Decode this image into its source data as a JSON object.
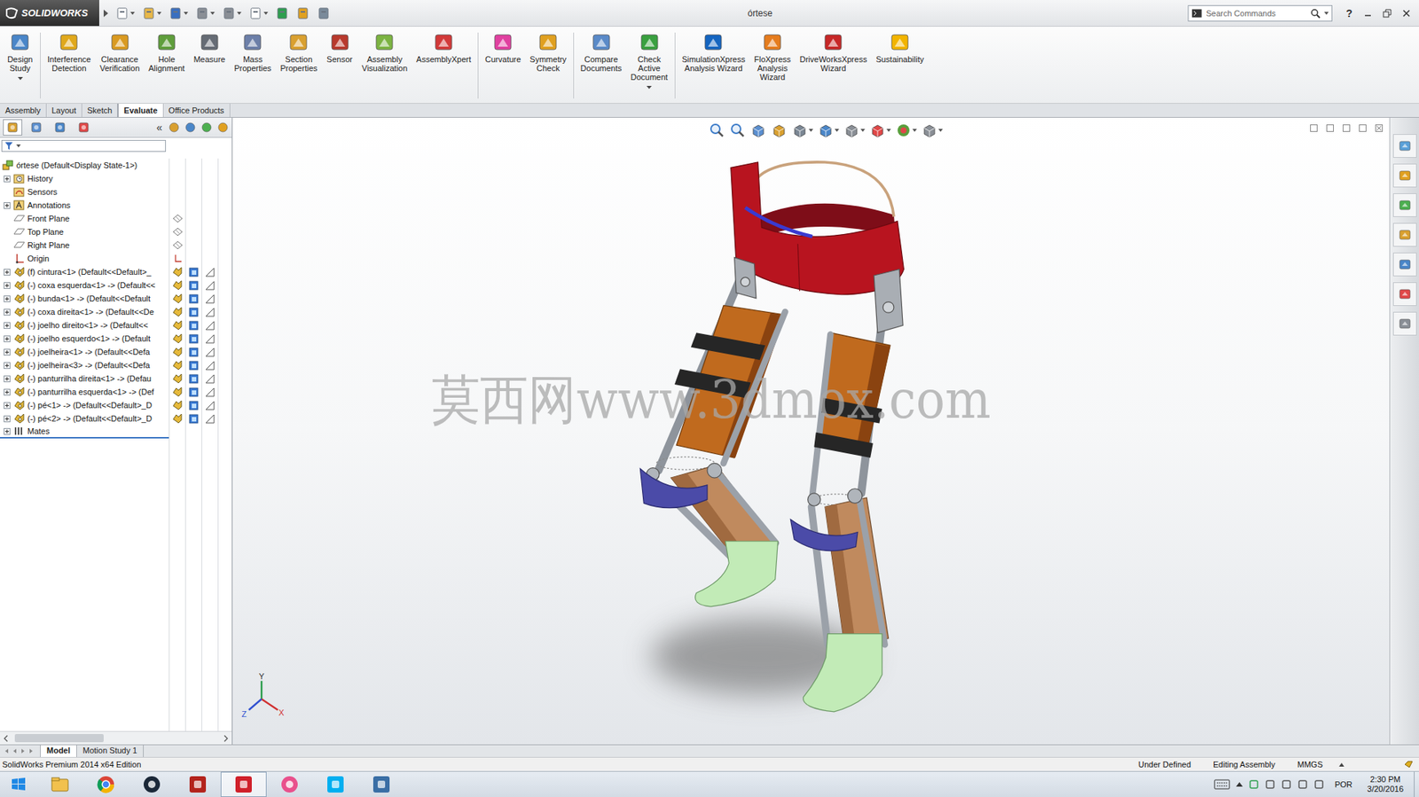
{
  "app": {
    "brand": "SOLIDWORKS"
  },
  "window": {
    "title": "órtese"
  },
  "search": {
    "placeholder": "Search Commands"
  },
  "help": "?",
  "ribbon": {
    "groups": [
      [
        {
          "label": [
            "Design",
            "Study"
          ],
          "dropdown": true
        }
      ],
      [
        {
          "label": [
            "Interference",
            "Detection"
          ],
          "dropdown": false
        },
        {
          "label": [
            "Clearance",
            "Verification"
          ],
          "dropdown": false
        },
        {
          "label": [
            "Hole",
            "Alignment"
          ],
          "dropdown": false
        },
        {
          "label": [
            "Measure"
          ],
          "dropdown": false
        },
        {
          "label": [
            "Mass",
            "Properties"
          ],
          "dropdown": false
        },
        {
          "label": [
            "Section",
            "Properties"
          ],
          "dropdown": false
        },
        {
          "label": [
            "Sensor"
          ],
          "dropdown": false
        },
        {
          "label": [
            "Assembly",
            "Visualization"
          ],
          "dropdown": false
        },
        {
          "label": [
            "AssemblyXpert"
          ],
          "dropdown": false
        }
      ],
      [
        {
          "label": [
            "Curvature"
          ],
          "dropdown": false
        },
        {
          "label": [
            "Symmetry",
            "Check"
          ],
          "dropdown": false
        }
      ],
      [
        {
          "label": [
            "Compare",
            "Documents"
          ],
          "dropdown": false
        },
        {
          "label": [
            "Check",
            "Active",
            "Document"
          ],
          "dropdown": true
        }
      ],
      [
        {
          "label": [
            "SimulationXpress",
            "Analysis Wizard"
          ],
          "dropdown": false
        },
        {
          "label": [
            "FloXpress",
            "Analysis",
            "Wizard"
          ],
          "dropdown": false
        },
        {
          "label": [
            "DriveWorksXpress",
            "Wizard"
          ],
          "dropdown": false
        },
        {
          "label": [
            "Sustainability"
          ],
          "dropdown": false
        }
      ]
    ]
  },
  "tabs": [
    {
      "label": "Assembly",
      "selected": false
    },
    {
      "label": "Layout",
      "selected": false
    },
    {
      "label": "Sketch",
      "selected": false
    },
    {
      "label": "Evaluate",
      "selected": true
    },
    {
      "label": "Office Products",
      "selected": false
    }
  ],
  "panel": {
    "tabs": [
      {
        "selected": true
      },
      {
        "selected": false
      },
      {
        "selected": false
      },
      {
        "selected": false
      }
    ],
    "collapse": "«"
  },
  "tree": [
    {
      "text": "órtese (Default<Display State-1>)",
      "kind": "root",
      "expander": false,
      "expanded": true
    },
    {
      "text": "History",
      "kind": "history",
      "expander": true,
      "expanded": false
    },
    {
      "text": "Sensors",
      "kind": "sensors",
      "expander": false,
      "expanded": false
    },
    {
      "text": "Annotations",
      "kind": "annotations",
      "expander": true,
      "expanded": false
    },
    {
      "text": "Front Plane",
      "kind": "plane",
      "expander": false,
      "expanded": false
    },
    {
      "text": "Top Plane",
      "kind": "plane",
      "expander": false,
      "expanded": false
    },
    {
      "text": "Right Plane",
      "kind": "plane",
      "expander": false,
      "expanded": false
    },
    {
      "text": "Origin",
      "kind": "origin",
      "expander": false,
      "expanded": false
    },
    {
      "text": "(f) cintura<1> (Default<<Default>_",
      "kind": "component",
      "expander": true,
      "expanded": false
    },
    {
      "text": "(-) coxa esquerda<1> -> (Default<<",
      "kind": "component",
      "expander": true,
      "expanded": false
    },
    {
      "text": "(-) bunda<1> -> (Default<<Default",
      "kind": "component",
      "expander": true,
      "expanded": false
    },
    {
      "text": "(-) coxa direita<1> -> (Default<<De",
      "kind": "component",
      "expander": true,
      "expanded": false
    },
    {
      "text": "(-) joelho direito<1> -> (Default<<",
      "kind": "component",
      "expander": true,
      "expanded": false
    },
    {
      "text": "(-) joelho esquerdo<1> -> (Default",
      "kind": "component",
      "expander": true,
      "expanded": false
    },
    {
      "text": "(-) joelheira<1> -> (Default<<Defa",
      "kind": "component",
      "expander": true,
      "expanded": false
    },
    {
      "text": "(-) joelheira<3> -> (Default<<Defa",
      "kind": "component",
      "expander": true,
      "expanded": false
    },
    {
      "text": "(-) panturrilha direita<1> -> (Defau",
      "kind": "component",
      "expander": true,
      "expanded": false
    },
    {
      "text": "(-) panturrilha esquerda<1> -> (Def",
      "kind": "component",
      "expander": true,
      "expanded": false
    },
    {
      "text": "(-) pé<1> -> (Default<<Default>_D",
      "kind": "component",
      "expander": true,
      "expanded": false
    },
    {
      "text": "(-) pé<2> -> (Default<<Default>_D",
      "kind": "component",
      "expander": true,
      "expanded": false
    },
    {
      "text": "Mates",
      "kind": "mates",
      "expander": true,
      "expanded": false
    }
  ],
  "viewport": {
    "watermark": "莫西网www.3dmox.com",
    "triad": {
      "x": "X",
      "y": "Y",
      "z": "Z"
    }
  },
  "bottom_tabs": [
    {
      "label": "Model",
      "selected": true
    },
    {
      "label": "Motion Study 1",
      "selected": false
    }
  ],
  "status_bar": {
    "edition": "SolidWorks Premium 2014 x64 Edition",
    "items": [
      "Under Defined",
      "Editing Assembly",
      "MMGS"
    ]
  },
  "taskbar": {
    "apps": [
      {
        "selected": false
      },
      {
        "selected": false
      },
      {
        "selected": false
      },
      {
        "selected": false
      },
      {
        "selected": true
      },
      {
        "selected": false
      },
      {
        "selected": false
      },
      {
        "selected": false
      }
    ],
    "language": "POR",
    "time": "2:30 PM",
    "date": "3/20/2016"
  }
}
